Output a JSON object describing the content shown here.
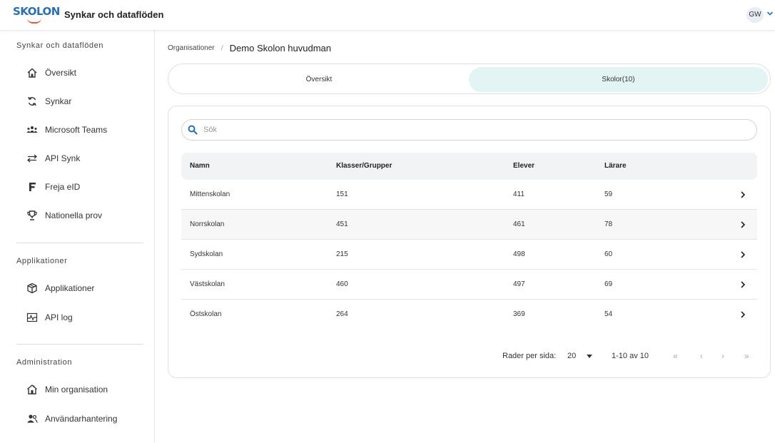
{
  "app": {
    "logo_text": "SKOLON",
    "title": "Synkar och dataflöden",
    "user_initials": "GW"
  },
  "sidebar": {
    "sections": [
      {
        "title": "Synkar och dataflöden",
        "items": [
          {
            "label": "Översikt",
            "icon": "home-icon"
          },
          {
            "label": "Synkar",
            "icon": "sync-icon"
          },
          {
            "label": "Microsoft Teams",
            "icon": "teams-icon"
          },
          {
            "label": "API Synk",
            "icon": "swap-arrows-icon"
          },
          {
            "label": "Freja eID",
            "icon": "freja-f-icon"
          },
          {
            "label": "Nationella prov",
            "icon": "trophy-icon"
          }
        ]
      },
      {
        "title": "Applikationer",
        "items": [
          {
            "label": "Applikationer",
            "icon": "cube-icon"
          },
          {
            "label": "API log",
            "icon": "pulse-chart-icon"
          }
        ]
      },
      {
        "title": "Administration",
        "items": [
          {
            "label": "Min organisation",
            "icon": "school-building-icon"
          },
          {
            "label": "Användarhantering",
            "icon": "users-icon"
          }
        ]
      }
    ]
  },
  "breadcrumb": {
    "parent": "Organisationer",
    "separator": "/",
    "current": "Demo Skolon huvudman"
  },
  "tabs": [
    {
      "label": "Översikt",
      "active": false
    },
    {
      "label": "Skolor(10)",
      "active": true
    }
  ],
  "search": {
    "placeholder": "Sök",
    "value": ""
  },
  "table": {
    "columns": [
      "Namn",
      "Klasser/Grupper",
      "Elever",
      "Lärare"
    ],
    "rows": [
      [
        "Mittenskolan",
        "151",
        "411",
        "59"
      ],
      [
        "Norrskolan",
        "451",
        "461",
        "78"
      ],
      [
        "Sydskolan",
        "215",
        "498",
        "60"
      ],
      [
        "Västskolan",
        "460",
        "497",
        "69"
      ],
      [
        "Östskolan",
        "264",
        "369",
        "54"
      ]
    ]
  },
  "pagination": {
    "rows_per_page_label": "Rader per sida:",
    "rows_per_page_value": "20",
    "range": "1-10 av 10",
    "first": "«",
    "prev": "‹",
    "next": "›",
    "last": "»"
  },
  "colors": {
    "accent_tab": "#e2f4f4",
    "search_icon": "#2a6fb5",
    "logo_blue": "#2a6fb5",
    "logo_red": "#e8543c"
  }
}
